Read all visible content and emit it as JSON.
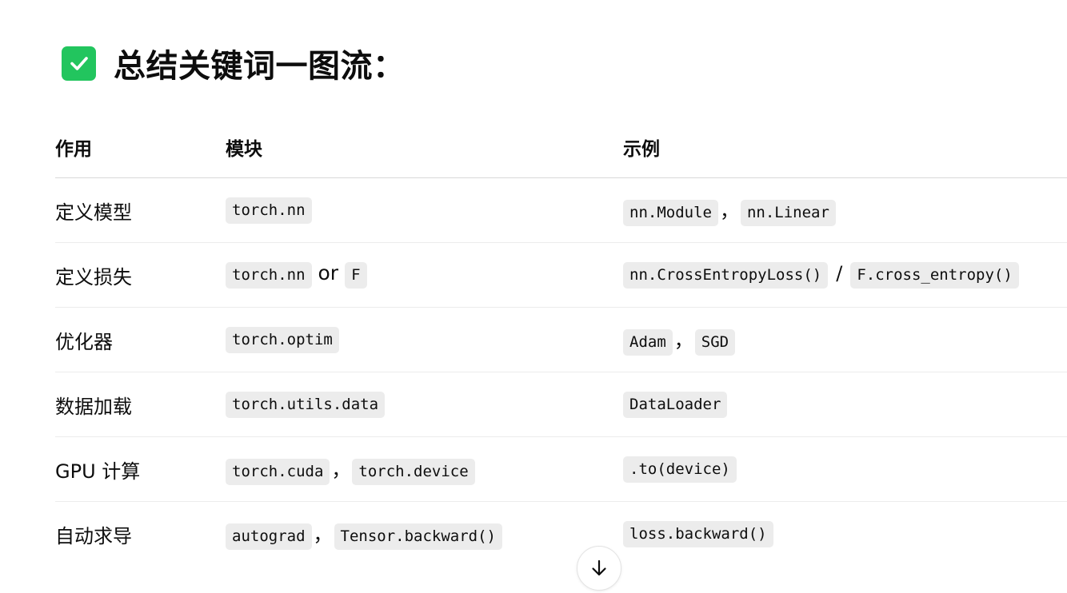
{
  "heading": {
    "icon": "check-box-icon",
    "text": "总结关键词一图流：",
    "icon_color": "#22c55e"
  },
  "table": {
    "headers": [
      "作用",
      "模块",
      "示例"
    ],
    "rows": [
      {
        "purpose": "定义模型",
        "module": [
          "torch.nn"
        ],
        "module_sep": [],
        "example": [
          "nn.Module",
          "nn.Linear"
        ],
        "example_sep": [
          "，"
        ]
      },
      {
        "purpose": "定义损失",
        "module": [
          "torch.nn",
          "F"
        ],
        "module_sep": [
          "or"
        ],
        "example": [
          "nn.CrossEntropyLoss()",
          "F.cross_entropy()"
        ],
        "example_sep": [
          "/"
        ]
      },
      {
        "purpose": "优化器",
        "module": [
          "torch.optim"
        ],
        "module_sep": [],
        "example": [
          "Adam",
          "SGD"
        ],
        "example_sep": [
          "，"
        ]
      },
      {
        "purpose": "数据加载",
        "module": [
          "torch.utils.data"
        ],
        "module_sep": [],
        "example": [
          "DataLoader"
        ],
        "example_sep": []
      },
      {
        "purpose": "GPU 计算",
        "module": [
          "torch.cuda",
          "torch.device"
        ],
        "module_sep": [
          "，"
        ],
        "example": [
          ".to(device)"
        ],
        "example_sep": []
      },
      {
        "purpose": "自动求导",
        "module": [
          "autograd",
          "Tensor.backward()"
        ],
        "module_sep": [
          "，"
        ],
        "example": [
          "loss.backward()"
        ],
        "example_sep": []
      }
    ]
  },
  "scroll_button": {
    "icon": "arrow-down-icon"
  }
}
